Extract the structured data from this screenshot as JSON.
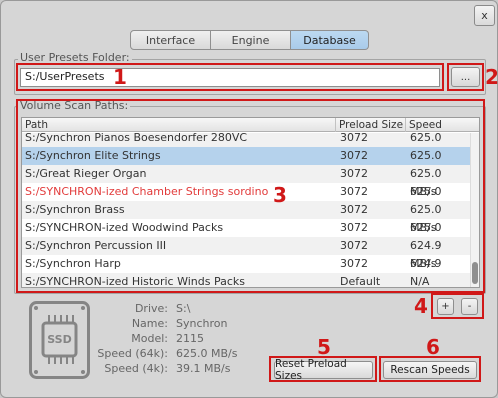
{
  "window": {
    "close_label": "x"
  },
  "tabs": [
    {
      "label": "Interface",
      "active": false
    },
    {
      "label": "Engine",
      "active": false
    },
    {
      "label": "Database",
      "active": true
    }
  ],
  "user_presets": {
    "label": "User Presets Folder:",
    "value": "S:/UserPresets",
    "browse_label": "..."
  },
  "volume_scan": {
    "label": "Volume Scan Paths:",
    "columns": [
      "Path",
      "Preload Size",
      "Speed"
    ],
    "rows": [
      {
        "path": "S:/Synchron Pianos Boesendorfer 280VC",
        "preload": "3072",
        "speed": "625.0 MB/s"
      },
      {
        "path": "S:/Synchron Elite Strings",
        "preload": "3072",
        "speed": "625.0 MB/s",
        "selected": true
      },
      {
        "path": "S:/Great Rieger Organ",
        "preload": "3072",
        "speed": "625.0 MB/s"
      },
      {
        "path": "S:/SYNCHRON-ized Chamber Strings sordino",
        "preload": "3072",
        "speed": "625.0 MB/s",
        "warning": true
      },
      {
        "path": "S:/Synchron Brass",
        "preload": "3072",
        "speed": "625.0 MB/s"
      },
      {
        "path": "S:/SYNCHRON-ized Woodwind Packs",
        "preload": "3072",
        "speed": "625.0 MB/s"
      },
      {
        "path": "S:/Synchron Percussion III",
        "preload": "3072",
        "speed": "624.9 MB/s"
      },
      {
        "path": "S:/Synchron Harp",
        "preload": "3072",
        "speed": "624.9 MB/s"
      },
      {
        "path": "S:/SYNCHRON-ized Historic Winds Packs",
        "preload": "Default",
        "speed": "N/A"
      }
    ],
    "add_label": "+",
    "remove_label": "-"
  },
  "drive_info": {
    "icon_label": "SSD",
    "fields": [
      {
        "key": "Drive:",
        "value": "S:\\"
      },
      {
        "key": "Name:",
        "value": "Synchron"
      },
      {
        "key": "Model:",
        "value": "2115"
      },
      {
        "key": "Speed (64k):",
        "value": "625.0 MB/s"
      },
      {
        "key": "Speed (4k):",
        "value": "39.1 MB/s"
      }
    ]
  },
  "buttons": {
    "reset_preload": "Reset Preload Sizes",
    "rescan_speeds": "Rescan Speeds"
  },
  "annotations": [
    "1",
    "2",
    "3",
    "4",
    "5",
    "6"
  ],
  "colors": {
    "accent_selected_row": "#b5d2ec",
    "active_tab": "#aecdeb",
    "warning_text": "#e23b3b",
    "annotation_red": "#d01818"
  }
}
